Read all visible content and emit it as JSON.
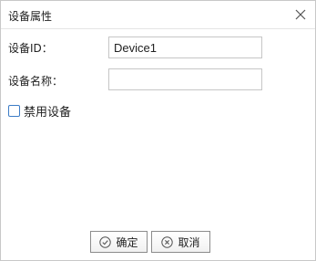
{
  "dialog": {
    "title": "设备属性",
    "close_icon": "close-icon"
  },
  "form": {
    "device_id_label": "设备ID：",
    "device_id_value": "Device1",
    "device_name_label": "设备名称：",
    "device_name_value": "",
    "disable_label": "禁用设备",
    "disable_checked": false
  },
  "buttons": {
    "ok_label": "确定",
    "ok_icon": "check-circle-icon",
    "cancel_label": "取消",
    "cancel_icon": "x-circle-icon"
  },
  "colors": {
    "checkbox_border": "#3c7cc6",
    "button_border": "#8c8c8c"
  }
}
